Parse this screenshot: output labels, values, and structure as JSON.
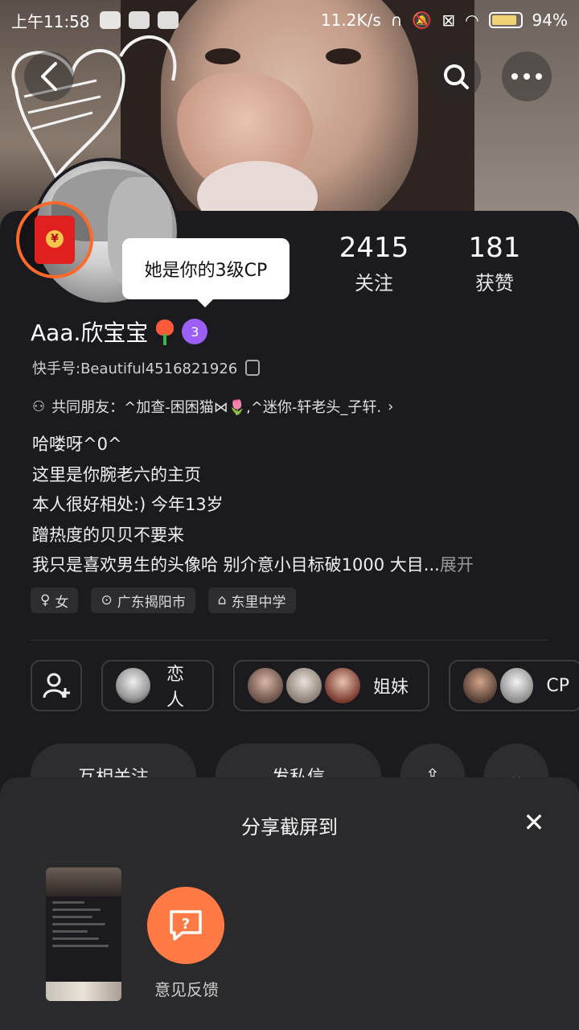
{
  "status_bar": {
    "time": "上午11:58",
    "speed": "11.2K/s",
    "battery": "94%"
  },
  "nav": {
    "back_icon": "back-arrow-icon",
    "search_icon": "search-icon",
    "more_icon": "more-icon"
  },
  "stats": {
    "following_count": "2415",
    "following_label": "关注",
    "likes_count": "181",
    "likes_label": "获赞"
  },
  "tooltip": "她是你的3级CP",
  "profile": {
    "name": "Aaa.欣宝宝",
    "level_badge": "3",
    "kuaishou_id": "快手号:Beautiful4516821926",
    "common_friends": "共同朋友：^加查-困困猫⋈🌷,^迷你-轩老头_子轩.",
    "bio_lines": [
      "哈喽呀^0^",
      "这里是你腕老六的主页",
      "本人很好相处:)   今年13岁",
      "蹭热度的贝贝不要来",
      "我只是喜欢男生的头像哈  别介意小目标破1000  大目..."
    ],
    "bio_more": "展开"
  },
  "tags": [
    {
      "icon": "female-icon",
      "label": "女"
    },
    {
      "icon": "location-icon",
      "label": "广东揭阳市"
    },
    {
      "icon": "school-icon",
      "label": "东里中学"
    }
  ],
  "relations": {
    "add_friend_icon": "add-friend-icon",
    "lover_label": "恋人",
    "sisters_label": "姐妹",
    "cp_label": "CP"
  },
  "actions": {
    "mutual_follow": "互相关注",
    "send_message": "发私信"
  },
  "share_panel": {
    "title": "分享截屏到",
    "feedback_label": "意见反馈"
  },
  "colors": {
    "background": "#1b1b1f",
    "accent_orange": "#ff7a45",
    "badge_purple": "#9b5ff6",
    "panel": "#2a2a2d"
  }
}
